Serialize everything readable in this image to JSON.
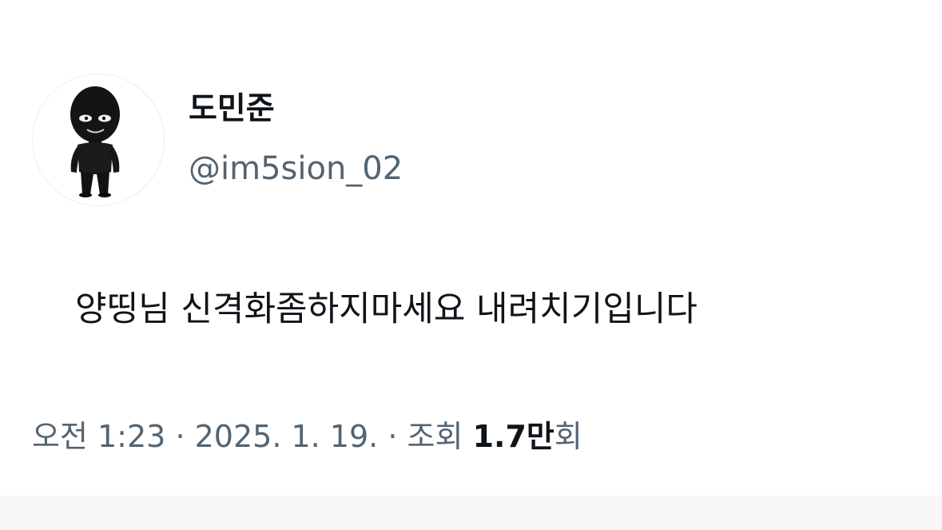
{
  "tweet": {
    "author": {
      "display_name": "도민준",
      "handle": "@im5sion_02",
      "avatar": "black-figure-avatar"
    },
    "text": "양띵님 신격화좀하지마세요 내려치기입니다",
    "meta": {
      "time": "오전 1:23",
      "separator": "·",
      "date": "2025. 1. 19.",
      "views_label": "조회",
      "views_count": "1.7만",
      "views_suffix": "회"
    }
  },
  "colors": {
    "text_primary": "#0f1419",
    "text_secondary": "#536471",
    "background": "#ffffff"
  }
}
